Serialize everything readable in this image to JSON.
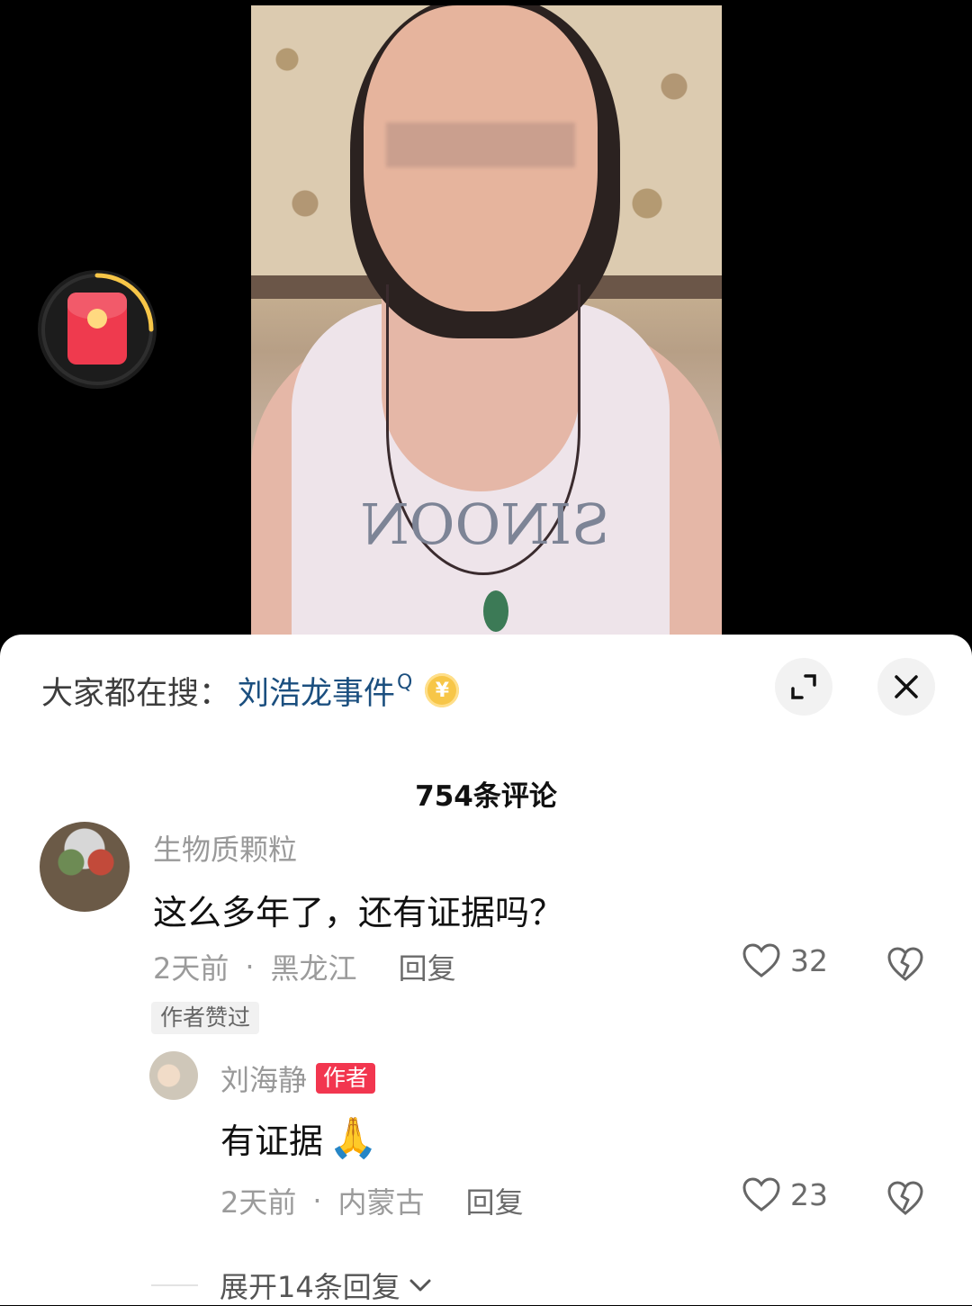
{
  "search_bar": {
    "prefix": "大家都在搜：",
    "term": "刘浩龙事件",
    "term_sup": "Q",
    "coin_symbol": "¥"
  },
  "sheet": {
    "comment_count": "754条评论"
  },
  "comments": [
    {
      "username": "生物质颗粒",
      "text": "这么多年了，还有证据吗？",
      "time": "2天前",
      "location": "黑龙江",
      "reply_label": "回复",
      "likes": "32",
      "author_liked_label": "作者赞过"
    },
    {
      "username": "刘海静",
      "badge": "作者",
      "text": "有证据",
      "emoji": "🙏",
      "time": "2天前",
      "location": "内蒙古",
      "reply_label": "回复",
      "likes": "23"
    }
  ],
  "expand_replies": {
    "label": "展开14条回复"
  },
  "colors": {
    "search_term": "#1b4f7f",
    "author_badge": "#f2364f",
    "red_packet": "#ef3a4e",
    "red_packet_progress": "#f7c648"
  },
  "icons": [
    "red-packet-icon",
    "coin-icon",
    "expand-icon",
    "close-icon",
    "heart-icon",
    "dislike-heart-icon",
    "pray-icon",
    "chevron-down-icon"
  ]
}
